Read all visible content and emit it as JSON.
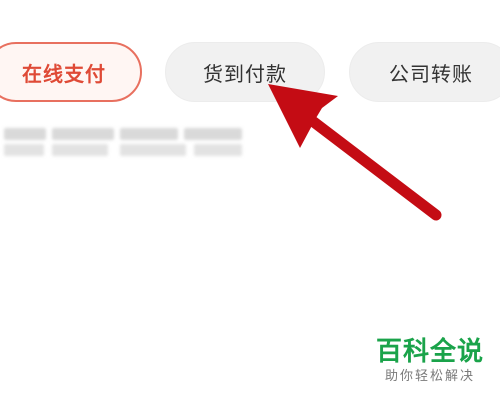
{
  "payment_methods": [
    {
      "label": "在线支付",
      "selected": true
    },
    {
      "label": "货到付款",
      "selected": false
    },
    {
      "label": "公司转账",
      "selected": false
    }
  ],
  "annotation": {
    "type": "arrow",
    "color": "#c40c14",
    "points_to": "货到付款"
  },
  "watermark": {
    "title": "百科全说",
    "slogan": "助你轻松解决",
    "color": "#1aa34a"
  },
  "colors": {
    "selected_border": "#e8705f",
    "selected_text": "#df4a36",
    "option_background": "#f1f1f1"
  }
}
